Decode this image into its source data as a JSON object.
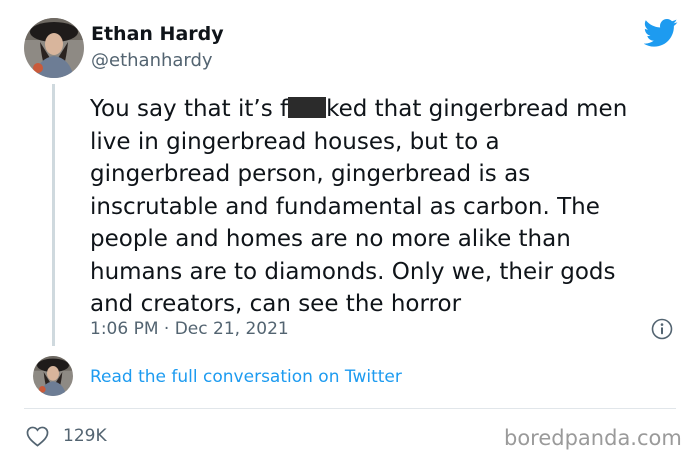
{
  "tweet": {
    "author_name": "Ethan Hardy",
    "author_handle": "@ethanhardy",
    "text_before_redaction": "You say that it’s f",
    "text_after_redaction": "ked that gingerbread men\nlive in gingerbread houses, but to a\ngingerbread person, gingerbread is as\ninscrutable and fundamental as carbon. The\npeople and homes are no more alike than\nhumans are to diamonds. Only we, their gods\nand creators, can see the horror",
    "timestamp": "1:06 PM · Dec 21, 2021",
    "conversation_link": "Read the full conversation on Twitter",
    "likes": "129K"
  },
  "watermark": "boredpanda.com",
  "icons": {
    "platform": "twitter-bird-icon",
    "info": "info-icon",
    "like": "heart-icon"
  },
  "colors": {
    "twitter_blue": "#1d9bf0",
    "text_primary": "#0f1419",
    "text_secondary": "#536471",
    "redaction": "#2b2b2b"
  }
}
